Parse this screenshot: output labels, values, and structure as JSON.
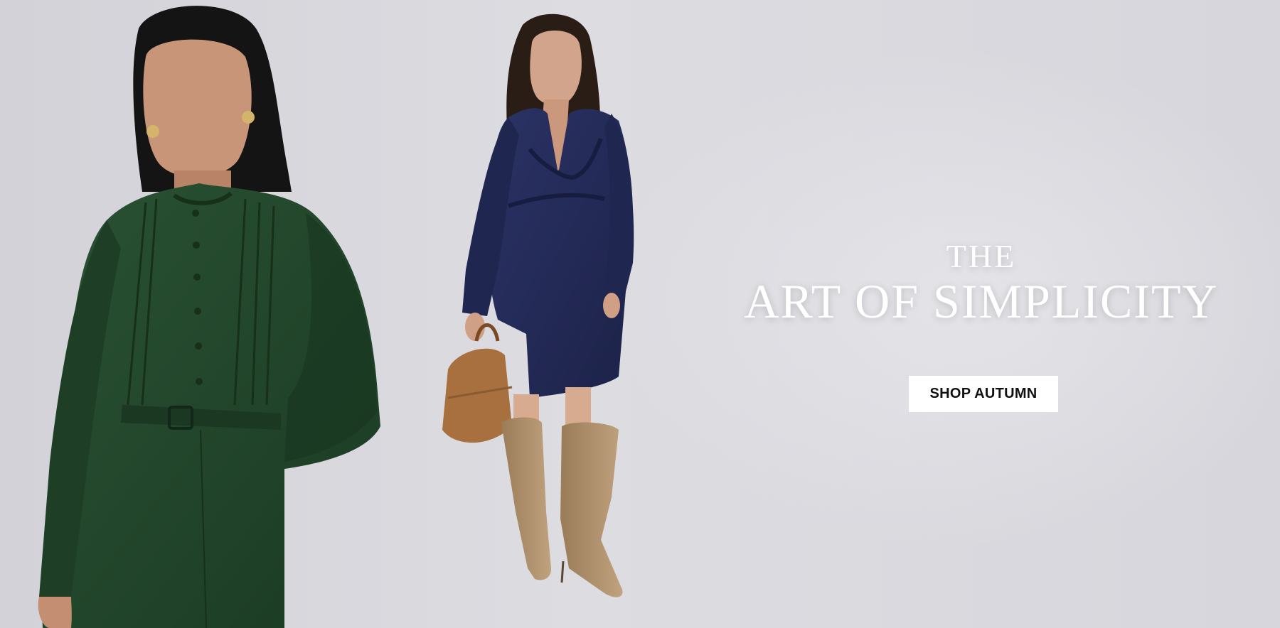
{
  "hero": {
    "headline_pre": "THE",
    "headline_main": "ART OF SIMPLICITY",
    "cta_label": "SHOP AUTUMN",
    "photo": {
      "alt_left": "Model in green belted shirt dress",
      "alt_right": "Model in navy ruffle mini dress with tan boots and brown handbag"
    },
    "colors": {
      "background": "#d9d9de",
      "green_dress": "#1f4229",
      "navy_dress": "#232a55",
      "boots": "#b0926e",
      "bag": "#a8703e",
      "cta_bg": "#ffffff",
      "cta_text": "#111111"
    }
  }
}
